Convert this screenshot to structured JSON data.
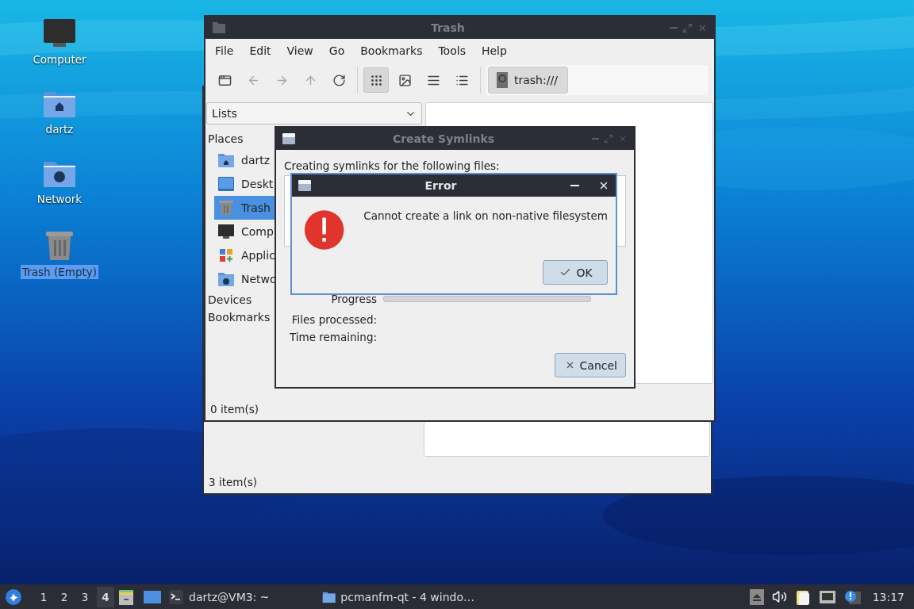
{
  "desktop_icons": [
    {
      "kind": "computer",
      "label": "Computer",
      "selected": false
    },
    {
      "kind": "home",
      "label": "dartz",
      "selected": false
    },
    {
      "kind": "network",
      "label": "Network",
      "selected": false
    },
    {
      "kind": "trash",
      "label": "Trash (Empty)",
      "selected": true
    }
  ],
  "back_window": {
    "status": "3 item(s)"
  },
  "file_manager": {
    "title": "Trash",
    "menu": [
      "File",
      "Edit",
      "View",
      "Go",
      "Bookmarks",
      "Tools",
      "Help"
    ],
    "toolbar": [
      {
        "kind": "new-window",
        "disabled": false,
        "selected": false
      },
      {
        "kind": "back",
        "disabled": true,
        "selected": false
      },
      {
        "kind": "forward",
        "disabled": true,
        "selected": false
      },
      {
        "kind": "up",
        "disabled": true,
        "selected": false
      },
      {
        "kind": "reload",
        "disabled": false,
        "selected": false
      },
      {
        "kind": "icon-view",
        "disabled": false,
        "selected": true
      },
      {
        "kind": "thumbnail-view",
        "disabled": false,
        "selected": false
      },
      {
        "kind": "compact-view",
        "disabled": false,
        "selected": false
      },
      {
        "kind": "detailed-view",
        "disabled": false,
        "selected": false
      }
    ],
    "path": "trash:///",
    "side_pane_mode": "Lists",
    "places_header": "Places",
    "places": [
      {
        "kind": "home",
        "label": "dartz",
        "selected": false
      },
      {
        "kind": "desktop",
        "label": "Deskt",
        "selected": false
      },
      {
        "kind": "trash",
        "label": "Trash",
        "selected": true
      },
      {
        "kind": "computer",
        "label": "Comp",
        "selected": false
      },
      {
        "kind": "apps",
        "label": "Applic",
        "selected": false
      },
      {
        "kind": "network",
        "label": "Netwo",
        "selected": false
      }
    ],
    "sections": [
      "Devices",
      "Bookmarks"
    ],
    "status": "0 item(s)"
  },
  "symlink_dialog": {
    "title": "Create Symlinks",
    "message": "Creating symlinks for the following files:",
    "progress_label": "Progress",
    "progress": {
      "level": 0
    },
    "files_processed_label": "Files processed:",
    "time_remaining_label": "Time remaining:",
    "cancel": "Cancel"
  },
  "error_dialog": {
    "title": "Error",
    "message": "Cannot create a link on non-native filesystem",
    "ok": "OK"
  },
  "taskbar": {
    "workspaces": [
      {
        "label": "1",
        "selected": false
      },
      {
        "label": "2",
        "selected": false
      },
      {
        "label": "3",
        "selected": false
      },
      {
        "label": "4",
        "selected": true
      }
    ],
    "tasks": [
      {
        "kind": "terminal",
        "label": "dartz@VM3: ~"
      },
      {
        "kind": "folder",
        "label": "pcmanfm-qt - 4 windo…"
      }
    ],
    "clock": "13:17"
  }
}
